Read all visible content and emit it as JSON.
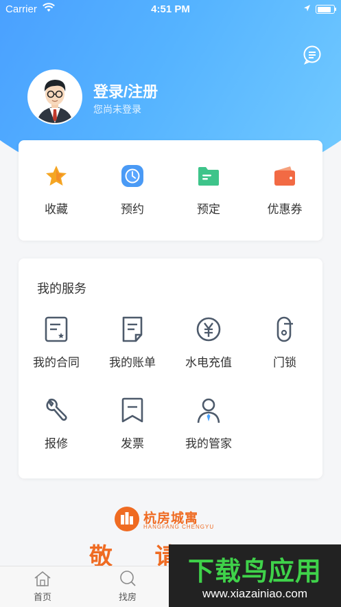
{
  "status_bar": {
    "carrier": "Carrier",
    "time": "4:51 PM",
    "battery_level": 0.9
  },
  "profile": {
    "title": "登录/注册",
    "subtitle": "您尚未登录"
  },
  "header": {
    "message_icon": "chat-bubble-icon"
  },
  "quick_actions": [
    {
      "label": "收藏",
      "icon": "star-icon"
    },
    {
      "label": "预约",
      "icon": "clock-icon"
    },
    {
      "label": "预定",
      "icon": "folder-icon"
    },
    {
      "label": "优惠券",
      "icon": "wallet-icon"
    }
  ],
  "services": {
    "title": "我的服务",
    "items": [
      {
        "label": "我的合同",
        "icon": "contract-icon"
      },
      {
        "label": "我的账单",
        "icon": "bill-icon"
      },
      {
        "label": "水电充值",
        "icon": "yuan-coin-icon"
      },
      {
        "label": "门锁",
        "icon": "door-lock-icon"
      },
      {
        "label": "报修",
        "icon": "wrench-icon"
      },
      {
        "label": "发票",
        "icon": "invoice-icon"
      },
      {
        "label": "我的管家",
        "icon": "person-icon"
      }
    ]
  },
  "brand": {
    "name": "杭房城寓",
    "name_en": "HANGFANG CHENGYU",
    "slogan": "敬 请"
  },
  "tab_bar": [
    {
      "label": "首页",
      "icon": "home-icon"
    },
    {
      "label": "找房",
      "icon": "search-icon"
    }
  ],
  "watermark": {
    "title": "下载鸟应用",
    "url": "www.xiazainiao.com"
  },
  "colors": {
    "accent_blue": "#3d8bff",
    "brand_orange": "#ef6b22",
    "icon_slate": "#4d5a6b"
  }
}
